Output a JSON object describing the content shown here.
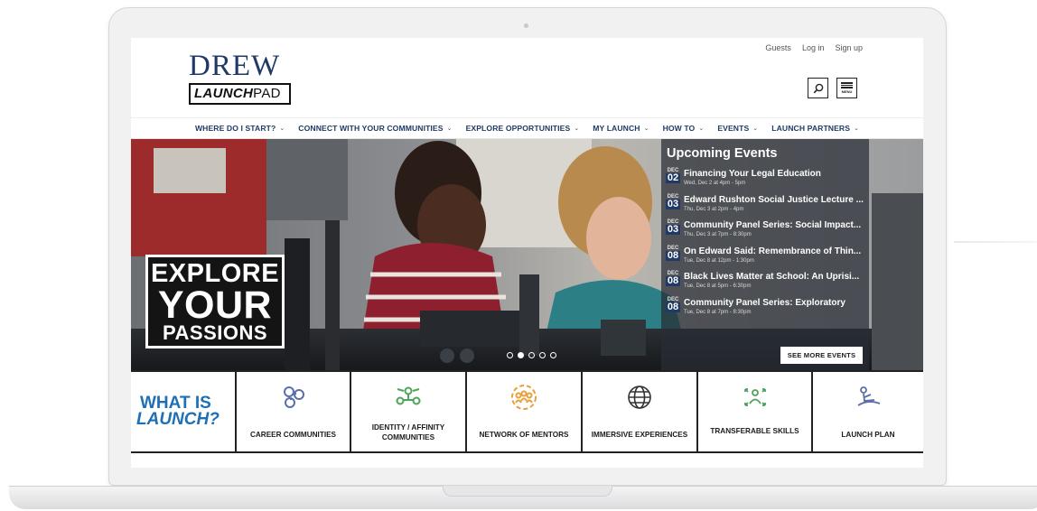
{
  "header": {
    "logo_main": "DREW",
    "logo_launch_bold": "LAUNCH",
    "logo_launch_thin": "PAD",
    "top_links": [
      "Guests",
      "Log in",
      "Sign up"
    ],
    "menu_label": "MENU"
  },
  "nav": {
    "items": [
      "WHERE DO I START?",
      "CONNECT WITH YOUR COMMUNITIES",
      "EXPLORE OPPORTUNITIES",
      "MY LAUNCH",
      "HOW TO",
      "EVENTS",
      "LAUNCH PARTNERS"
    ]
  },
  "hero": {
    "line1": "EXPLORE",
    "line2": "YOUR",
    "line3": "PASSIONS",
    "slide_count": 5,
    "active_slide": 2
  },
  "events": {
    "title": "Upcoming Events",
    "items": [
      {
        "month": "DEC",
        "day": "02",
        "title": "Financing Your Legal Education",
        "time": "Wed, Dec 2 at 4pm - 5pm"
      },
      {
        "month": "DEC",
        "day": "03",
        "title": "Edward Rushton Social Justice Lecture ...",
        "time": "Thu, Dec 3 at 2pm - 4pm"
      },
      {
        "month": "DEC",
        "day": "03",
        "title": "Community Panel Series: Social Impact...",
        "time": "Thu, Dec 3 at 7pm - 8:30pm"
      },
      {
        "month": "DEC",
        "day": "08",
        "title": "On Edward Said: Remembrance of Thin...",
        "time": "Tue, Dec 8 at 12pm - 1:30pm"
      },
      {
        "month": "DEC",
        "day": "08",
        "title": "Black Lives Matter at School: An Uprisi...",
        "time": "Tue, Dec 8 at 5pm - 6:30pm"
      },
      {
        "month": "DEC",
        "day": "08",
        "title": "Community Panel Series: Exploratory",
        "time": "Tue, Dec 8 at 7pm - 8:30pm"
      }
    ],
    "see_more": "SEE MORE EVENTS"
  },
  "tiles": {
    "what_line1": "WHAT IS",
    "what_line2": "LAUNCH?",
    "items": [
      {
        "label": "CAREER COMMUNITIES",
        "icon": "chain-links-icon"
      },
      {
        "label": "IDENTITY / AFFINITY COMMUNITIES",
        "icon": "people-network-icon"
      },
      {
        "label": "NETWORK OF MENTORS",
        "icon": "mentor-circle-icon"
      },
      {
        "label": "IMMERSIVE EXPERIENCES",
        "icon": "globe-icon"
      },
      {
        "label": "TRANSFERABLE SKILLS",
        "icon": "person-arrows-icon"
      },
      {
        "label": "LAUNCH PLAN",
        "icon": "person-reclining-icon"
      }
    ]
  },
  "colors": {
    "brand_navy": "#1f3a66",
    "launch_blue": "#1f6fb5",
    "icon_blue": "#5a6fa8",
    "icon_green": "#4fa35b",
    "icon_orange": "#e8a13a"
  }
}
